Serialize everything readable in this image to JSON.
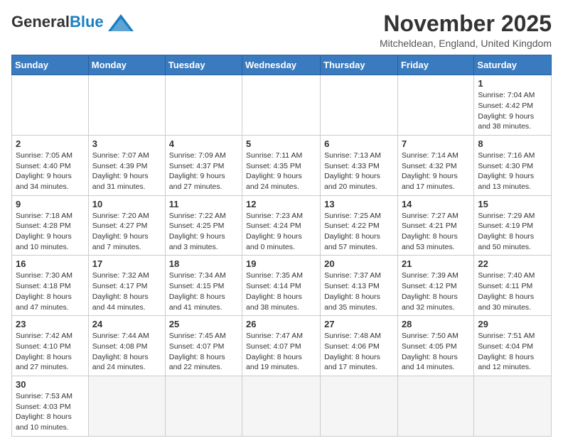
{
  "header": {
    "logo_line1": "General",
    "logo_line2": "Blue",
    "month": "November 2025",
    "location": "Mitcheldean, England, United Kingdom"
  },
  "days_of_week": [
    "Sunday",
    "Monday",
    "Tuesday",
    "Wednesday",
    "Thursday",
    "Friday",
    "Saturday"
  ],
  "weeks": [
    [
      {
        "day": "",
        "info": ""
      },
      {
        "day": "",
        "info": ""
      },
      {
        "day": "",
        "info": ""
      },
      {
        "day": "",
        "info": ""
      },
      {
        "day": "",
        "info": ""
      },
      {
        "day": "",
        "info": ""
      },
      {
        "day": "1",
        "info": "Sunrise: 7:04 AM\nSunset: 4:42 PM\nDaylight: 9 hours and 38 minutes."
      }
    ],
    [
      {
        "day": "2",
        "info": "Sunrise: 7:05 AM\nSunset: 4:40 PM\nDaylight: 9 hours and 34 minutes."
      },
      {
        "day": "3",
        "info": "Sunrise: 7:07 AM\nSunset: 4:39 PM\nDaylight: 9 hours and 31 minutes."
      },
      {
        "day": "4",
        "info": "Sunrise: 7:09 AM\nSunset: 4:37 PM\nDaylight: 9 hours and 27 minutes."
      },
      {
        "day": "5",
        "info": "Sunrise: 7:11 AM\nSunset: 4:35 PM\nDaylight: 9 hours and 24 minutes."
      },
      {
        "day": "6",
        "info": "Sunrise: 7:13 AM\nSunset: 4:33 PM\nDaylight: 9 hours and 20 minutes."
      },
      {
        "day": "7",
        "info": "Sunrise: 7:14 AM\nSunset: 4:32 PM\nDaylight: 9 hours and 17 minutes."
      },
      {
        "day": "8",
        "info": "Sunrise: 7:16 AM\nSunset: 4:30 PM\nDaylight: 9 hours and 13 minutes."
      }
    ],
    [
      {
        "day": "9",
        "info": "Sunrise: 7:18 AM\nSunset: 4:28 PM\nDaylight: 9 hours and 10 minutes."
      },
      {
        "day": "10",
        "info": "Sunrise: 7:20 AM\nSunset: 4:27 PM\nDaylight: 9 hours and 7 minutes."
      },
      {
        "day": "11",
        "info": "Sunrise: 7:22 AM\nSunset: 4:25 PM\nDaylight: 9 hours and 3 minutes."
      },
      {
        "day": "12",
        "info": "Sunrise: 7:23 AM\nSunset: 4:24 PM\nDaylight: 9 hours and 0 minutes."
      },
      {
        "day": "13",
        "info": "Sunrise: 7:25 AM\nSunset: 4:22 PM\nDaylight: 8 hours and 57 minutes."
      },
      {
        "day": "14",
        "info": "Sunrise: 7:27 AM\nSunset: 4:21 PM\nDaylight: 8 hours and 53 minutes."
      },
      {
        "day": "15",
        "info": "Sunrise: 7:29 AM\nSunset: 4:19 PM\nDaylight: 8 hours and 50 minutes."
      }
    ],
    [
      {
        "day": "16",
        "info": "Sunrise: 7:30 AM\nSunset: 4:18 PM\nDaylight: 8 hours and 47 minutes."
      },
      {
        "day": "17",
        "info": "Sunrise: 7:32 AM\nSunset: 4:17 PM\nDaylight: 8 hours and 44 minutes."
      },
      {
        "day": "18",
        "info": "Sunrise: 7:34 AM\nSunset: 4:15 PM\nDaylight: 8 hours and 41 minutes."
      },
      {
        "day": "19",
        "info": "Sunrise: 7:35 AM\nSunset: 4:14 PM\nDaylight: 8 hours and 38 minutes."
      },
      {
        "day": "20",
        "info": "Sunrise: 7:37 AM\nSunset: 4:13 PM\nDaylight: 8 hours and 35 minutes."
      },
      {
        "day": "21",
        "info": "Sunrise: 7:39 AM\nSunset: 4:12 PM\nDaylight: 8 hours and 32 minutes."
      },
      {
        "day": "22",
        "info": "Sunrise: 7:40 AM\nSunset: 4:11 PM\nDaylight: 8 hours and 30 minutes."
      }
    ],
    [
      {
        "day": "23",
        "info": "Sunrise: 7:42 AM\nSunset: 4:10 PM\nDaylight: 8 hours and 27 minutes."
      },
      {
        "day": "24",
        "info": "Sunrise: 7:44 AM\nSunset: 4:08 PM\nDaylight: 8 hours and 24 minutes."
      },
      {
        "day": "25",
        "info": "Sunrise: 7:45 AM\nSunset: 4:07 PM\nDaylight: 8 hours and 22 minutes."
      },
      {
        "day": "26",
        "info": "Sunrise: 7:47 AM\nSunset: 4:07 PM\nDaylight: 8 hours and 19 minutes."
      },
      {
        "day": "27",
        "info": "Sunrise: 7:48 AM\nSunset: 4:06 PM\nDaylight: 8 hours and 17 minutes."
      },
      {
        "day": "28",
        "info": "Sunrise: 7:50 AM\nSunset: 4:05 PM\nDaylight: 8 hours and 14 minutes."
      },
      {
        "day": "29",
        "info": "Sunrise: 7:51 AM\nSunset: 4:04 PM\nDaylight: 8 hours and 12 minutes."
      }
    ],
    [
      {
        "day": "30",
        "info": "Sunrise: 7:53 AM\nSunset: 4:03 PM\nDaylight: 8 hours and 10 minutes."
      },
      {
        "day": "",
        "info": ""
      },
      {
        "day": "",
        "info": ""
      },
      {
        "day": "",
        "info": ""
      },
      {
        "day": "",
        "info": ""
      },
      {
        "day": "",
        "info": ""
      },
      {
        "day": "",
        "info": ""
      }
    ]
  ]
}
